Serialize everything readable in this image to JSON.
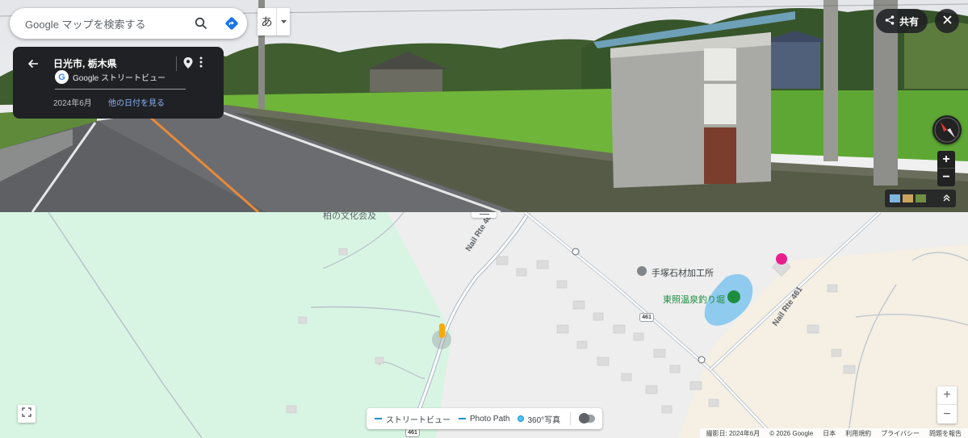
{
  "search": {
    "placeholder": "Google マップを検索する"
  },
  "ime": {
    "char": "あ"
  },
  "info_card": {
    "location": "日光市, 栃木県",
    "provider": "Google ストリートビュー",
    "date": "2024年6月",
    "other_dates": "他の日付を見る"
  },
  "toolbar": {
    "share_label": "共有"
  },
  "map": {
    "labels": {
      "poi_1": "手塚石材加工所",
      "poi_2": "東照温泉釣り堀",
      "partial_label": "柏の文化会及",
      "road_left": "Nail Rte 461",
      "road_right": "Nail Rte 461",
      "shield_1": "461",
      "shield_2": "461"
    },
    "legend": {
      "street_view": "ストリートビュー",
      "photo_path": "Photo Path",
      "photo_360": "360°写真"
    },
    "footer": {
      "capture_date": "撮影日: 2024年6月",
      "copyright": "© 2026 Google",
      "region": "日本",
      "terms": "利用規約",
      "privacy": "プライバシー",
      "report": "問題を報告"
    }
  },
  "colors": {
    "map_green": "#d8f5e3",
    "map_beige": "#f5efe4",
    "road": "#aab6c2",
    "pond": "#8ecbef",
    "card_bg": "#202124"
  }
}
